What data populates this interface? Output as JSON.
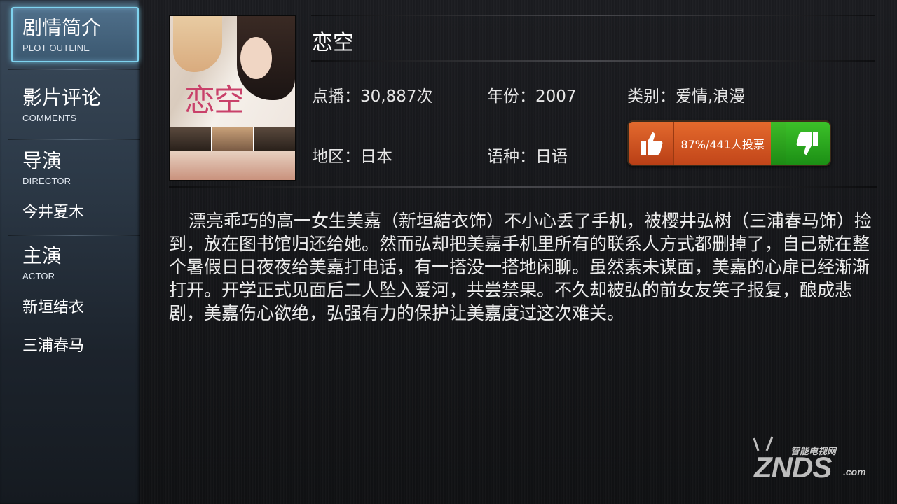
{
  "sidebar": {
    "plot": {
      "cn": "剧情简介",
      "en": "PLOT OUTLINE"
    },
    "comments": {
      "cn": "影片评论",
      "en": "COMMENTS"
    },
    "director": {
      "cn": "导演",
      "en": "DIRECTOR",
      "names": [
        "今井夏木"
      ]
    },
    "actor": {
      "cn": "主演",
      "en": "ACTOR",
      "names": [
        "新垣结衣",
        "三浦春马"
      ]
    }
  },
  "movie": {
    "title": "恋空",
    "plays": "点播：30,887次",
    "year": "年份：2007",
    "genre": "类别：爱情,浪漫",
    "region": "地区：日本",
    "language": "语种：日语",
    "poster_title": "恋空",
    "plot": "漂亮乖巧的高一女生美嘉（新垣結衣饰）不小心丢了手机，被樱井弘树（三浦春马饰）捡到，放在图书馆归还给她。然而弘却把美嘉手机里所有的联系人方式都删掉了，自己就在整个暑假日日夜夜给美嘉打电话，有一搭没一搭地闲聊。虽然素未谋面，美嘉的心扉已经渐渐打开。开学正式见面后二人坠入爱河，共尝禁果。不久却被弘的前女友笑子报复，酿成悲剧，美嘉伤心欲绝，弘强有力的保护让美嘉度过这次难关。"
  },
  "vote": {
    "label": "87%/441人投票",
    "up_percent": 87,
    "up_icon": "thumbs-up-icon",
    "down_icon": "thumbs-down-icon"
  },
  "watermark": {
    "small": "智能电视网",
    "big": "ZNDS",
    "com": ".com"
  }
}
